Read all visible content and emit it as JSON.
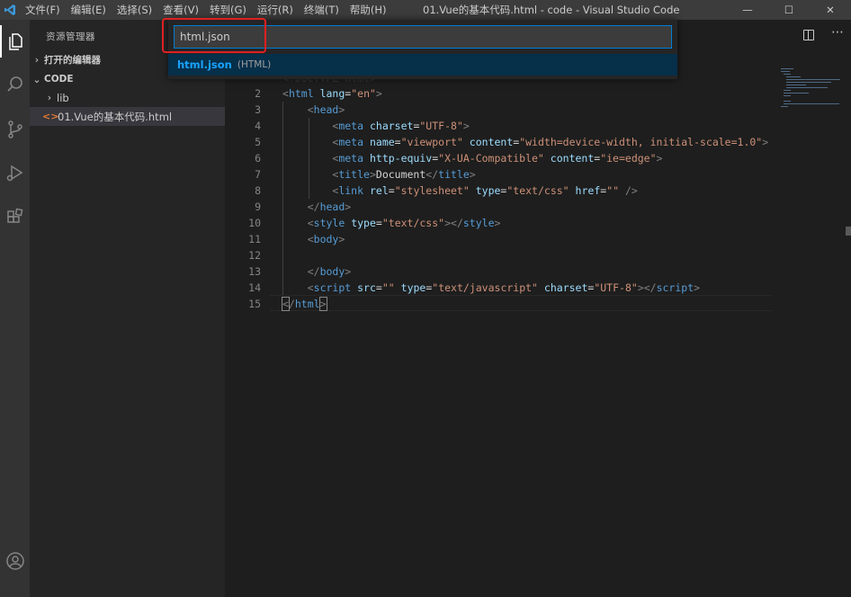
{
  "titlebar": {
    "menu": [
      "文件(F)",
      "编辑(E)",
      "选择(S)",
      "查看(V)",
      "转到(G)",
      "运行(R)",
      "终端(T)",
      "帮助(H)"
    ],
    "title": "01.Vue的基本代码.html - code - Visual Studio Code",
    "minimize": "—",
    "maximize": "☐",
    "close": "✕"
  },
  "activitybar": {
    "icons": [
      "files-icon",
      "search-icon",
      "source-control-icon",
      "run-debug-icon",
      "extensions-icon",
      "account-icon"
    ]
  },
  "sidebar": {
    "title": "资源管理器",
    "open_editors": "打开的编辑器",
    "folder": "CODE",
    "items": [
      {
        "label": "lib",
        "type": "folder"
      },
      {
        "label": "01.Vue的基本代码.html",
        "type": "html"
      }
    ]
  },
  "quickopen": {
    "input_value": "html.json",
    "result_name": "html.json",
    "result_desc": "(HTML)"
  },
  "editor": {
    "faded_first_line": "<!DOCTYPE html>",
    "line_numbers": [
      "2",
      "3",
      "4",
      "5",
      "6",
      "7",
      "8",
      "9",
      "10",
      "11",
      "12",
      "13",
      "14",
      "15"
    ]
  },
  "colors": {
    "accent": "#007fd4",
    "highlight_box": "#e02020",
    "tag": "#569cd6",
    "attr": "#9cdcfe",
    "string": "#ce9178"
  }
}
